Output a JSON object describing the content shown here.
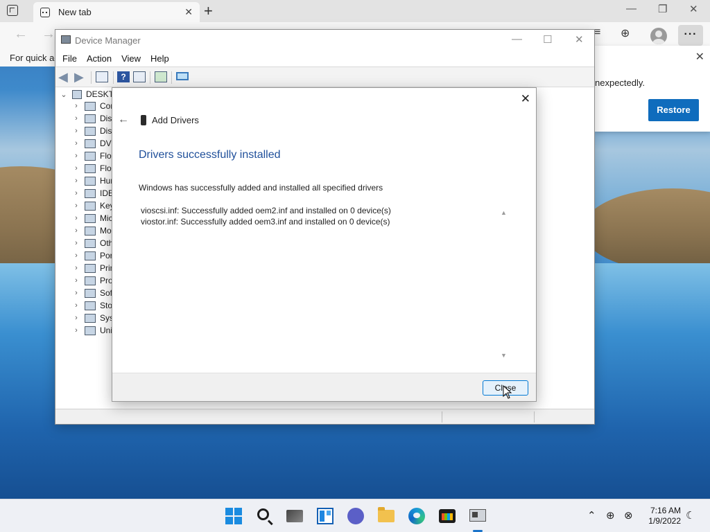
{
  "edge": {
    "tab_title": "New tab",
    "favorites_text": "For quick ac",
    "restore_message": "nexpectedly.",
    "restore_button": "Restore",
    "more_label": "···"
  },
  "device_manager": {
    "title": "Device Manager",
    "menu": [
      "File",
      "Action",
      "View",
      "Help"
    ],
    "tree_root": "DESKTC",
    "tree_items": [
      "Cor",
      "Disk",
      "Disp",
      "DVD",
      "Flop",
      "Flop",
      "Hun",
      "IDE",
      "Key",
      "Mic",
      "Mo",
      "Oth",
      "Por",
      "Prin",
      "Pro",
      "Soft",
      "Stor",
      "Syst",
      "Uni"
    ]
  },
  "dialog": {
    "header_title": "Add Drivers",
    "success_heading": "Drivers successfully installed",
    "description": "Windows has successfully added and installed all specified drivers",
    "results": [
      "vioscsi.inf: Successfully added oem2.inf and installed on 0 device(s)",
      "viostor.inf: Successfully added oem3.inf and installed on 0 device(s)"
    ],
    "close_button": "Close"
  },
  "taskbar": {
    "time": "7:16 AM",
    "date": "1/9/2022"
  }
}
